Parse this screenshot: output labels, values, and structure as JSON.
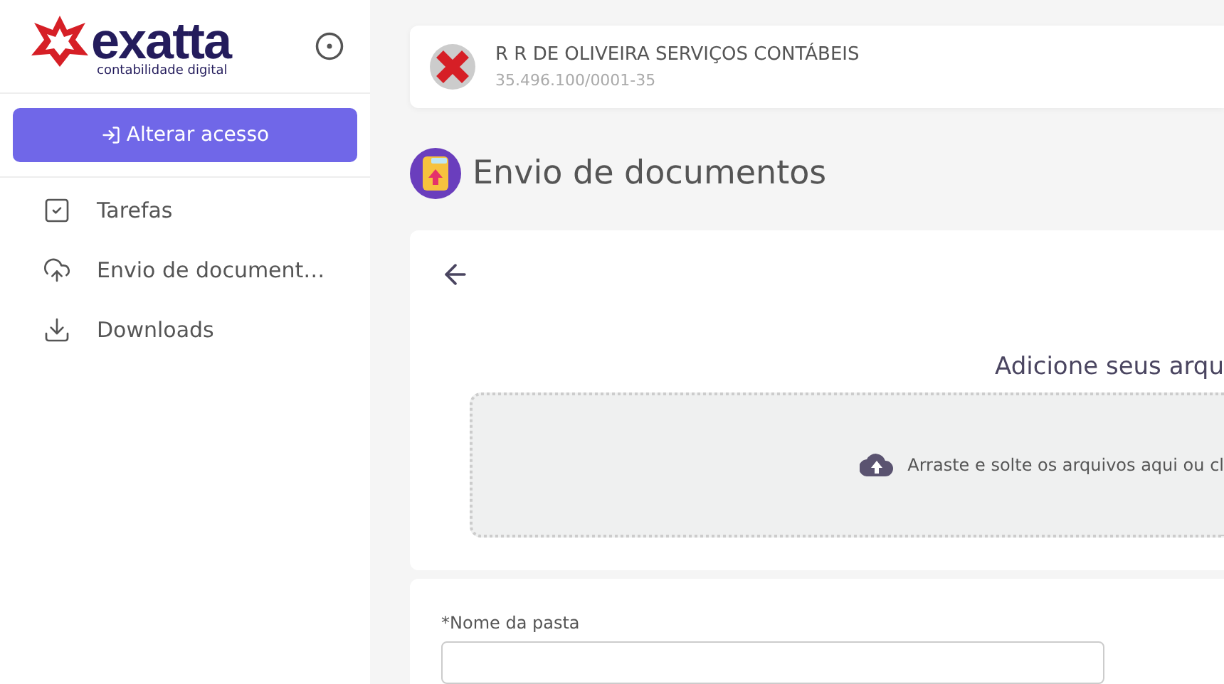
{
  "logo": {
    "name": "exatta",
    "tagline": "contabilidade digital"
  },
  "sidebar": {
    "button": "Alterar acesso",
    "items": [
      {
        "kind": "tasks",
        "label": "Tarefas",
        "selected": false
      },
      {
        "kind": "upload",
        "label": "Envio de document…",
        "selected": false
      },
      {
        "kind": "download",
        "label": "Downloads",
        "selected": false
      }
    ]
  },
  "company": {
    "name": "R R DE OLIVEIRA SERVIÇOS CONTÁBEIS",
    "cnpj": "35.496.100/0001-35"
  },
  "page_title": "Envio de documentos",
  "upload": {
    "heading": "Adicione seus arqu",
    "dropzone": "Arraste e solte os arquivos aqui ou cl"
  },
  "form": {
    "folder_label": "*Nome da pasta"
  }
}
